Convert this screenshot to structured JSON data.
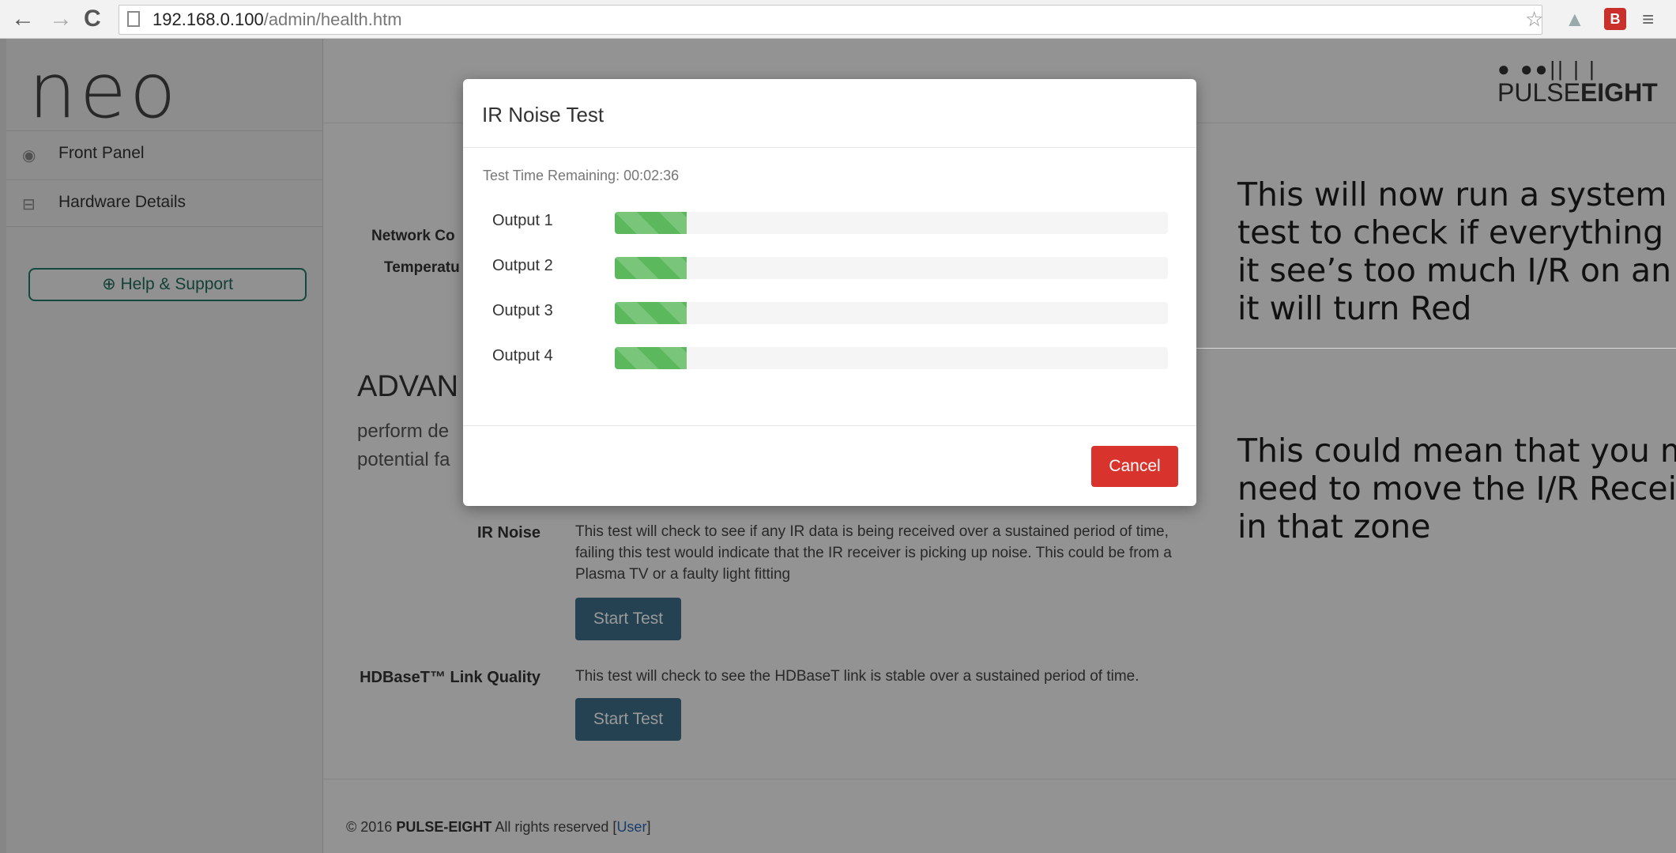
{
  "browser": {
    "url_host": "192.168.0.100",
    "url_path": "/admin/health.htm"
  },
  "sidebar": {
    "logo": "neo",
    "items": [
      {
        "label": "Front Panel",
        "icon": "radio-icon"
      },
      {
        "label": "Hardware Details",
        "icon": "drive-icon"
      }
    ],
    "help_label": "Help & Support"
  },
  "header": {
    "brand_dots": "● ●●|| | |",
    "brand_pulse": "PULSE",
    "brand_eight": "EIGHT"
  },
  "main": {
    "network_label": "Network Co",
    "temperature_label": "Temperatu",
    "advanced_title": "ADVAN",
    "advanced_desc_line1": "perform de",
    "advanced_desc_line2": "potential fa",
    "tests": [
      {
        "label": "IR Noise",
        "description": "This test will check to see if any IR data is being received over a sustained period of time, failing this test would indicate that the IR receiver is picking up noise. This could be from a Plasma TV or a faulty light fitting",
        "button": "Start Test"
      },
      {
        "label": "HDBaseT™ Link Quality",
        "description": "This test will check to see the HDBaseT link is stable over a sustained period of time.",
        "button": "Start Test"
      }
    ]
  },
  "footer": {
    "copyright": "© 2016",
    "company": "PULSE-EIGHT",
    "rights": "All rights reserved",
    "user_link": "User"
  },
  "modal": {
    "title": "IR Noise Test",
    "time_remaining": "Test Time Remaining: 00:02:36",
    "outputs": [
      {
        "label": "Output 1",
        "progress": 0.13
      },
      {
        "label": "Output 2",
        "progress": 0.13
      },
      {
        "label": "Output 3",
        "progress": 0.13
      },
      {
        "label": "Output 4",
        "progress": 0.13
      }
    ],
    "progress_color": "#5cb85c",
    "cancel_label": "Cancel",
    "cancel_color": "#d9332d"
  },
  "annotation": {
    "para1": [
      "This will now run a system w",
      "test to check if everything is",
      "it see’s too much I/R on an o",
      "it will turn Red"
    ],
    "para2": [
      "This could mean that you ma",
      "need to move the I/R Receiv",
      "in that zone"
    ]
  }
}
